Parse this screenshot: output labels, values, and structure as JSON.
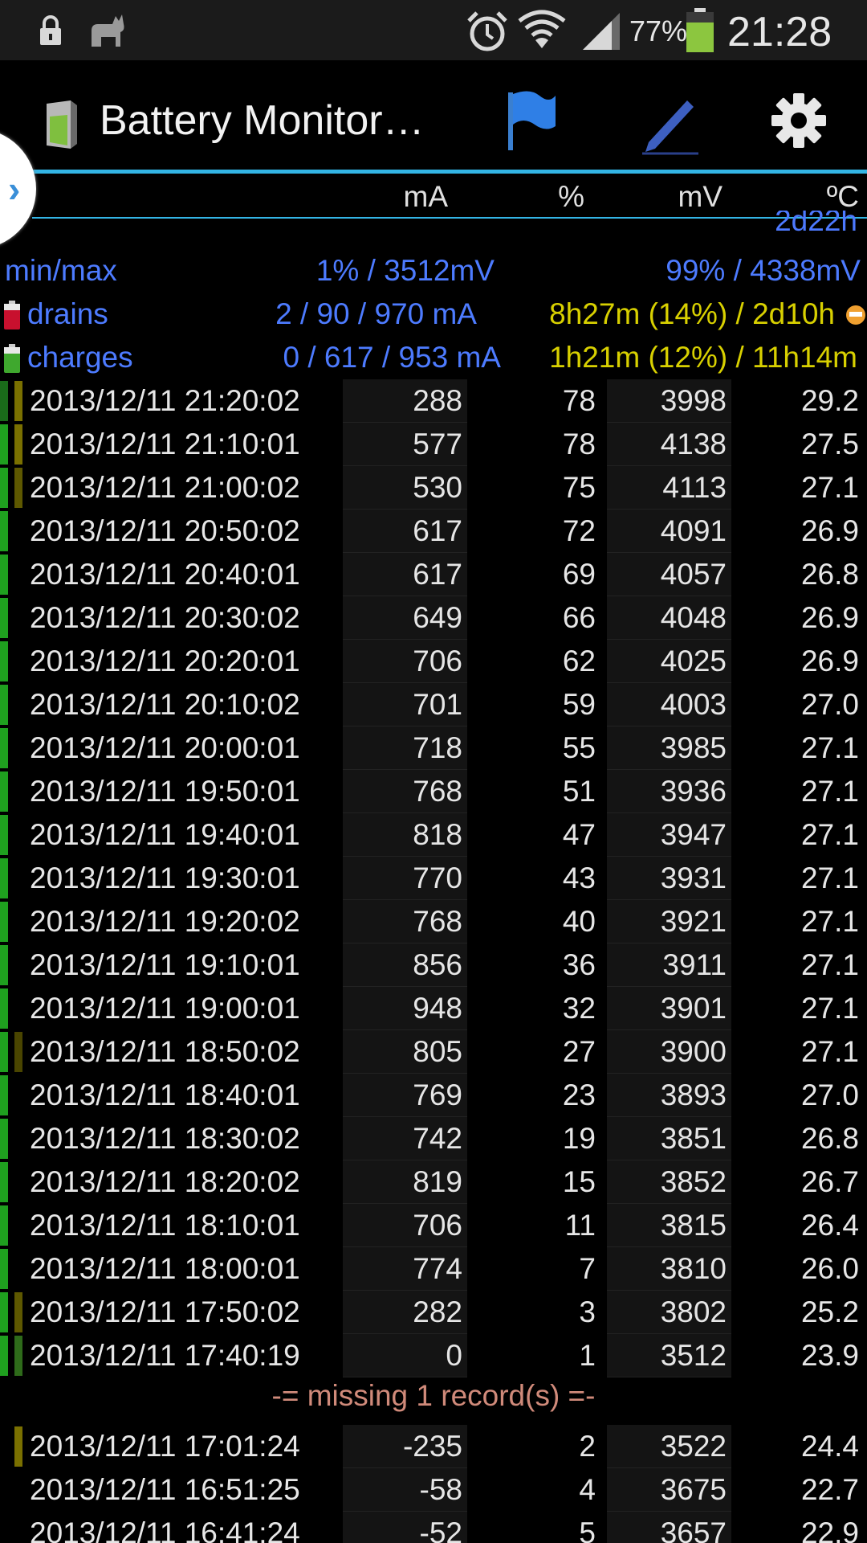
{
  "status_bar": {
    "battery_percent": "77%",
    "time": "21:28",
    "icons": [
      "lock-icon",
      "cat-icon",
      "alarm-icon",
      "wifi-icon",
      "signal-icon",
      "battery-icon"
    ]
  },
  "action_bar": {
    "title": "Battery Monitor…",
    "actions": [
      "flag-icon",
      "pencil-icon",
      "gear-icon"
    ]
  },
  "columns": {
    "ma": "mA",
    "pct": "%",
    "mv": "mV",
    "temp": "ºC"
  },
  "cut_text": "2d22h",
  "summary": {
    "minmax": {
      "label": "min/max",
      "left": "1% / 3512mV",
      "right": "99% / 4338mV"
    },
    "drains": {
      "label": "drains",
      "left": "2 / 90 / 970 mA",
      "right": "8h27m (14%) / 2d10h"
    },
    "charges": {
      "label": "charges",
      "left": "0 / 617 / 953 mA",
      "right": "1h21m (12%) / 11h14m"
    }
  },
  "rows": [
    {
      "ts": "2013/12/11  21:20:02",
      "ma": "288",
      "pct": "78",
      "mv": "3998",
      "temp": "29.2",
      "b1": "#1a6b1a",
      "b2": "#7a7000"
    },
    {
      "ts": "2013/12/11  21:10:01",
      "ma": "577",
      "pct": "78",
      "mv": "4138",
      "temp": "27.5",
      "b1": "#1fa01f",
      "b2": "#7a7000"
    },
    {
      "ts": "2013/12/11  21:00:02",
      "ma": "530",
      "pct": "75",
      "mv": "4113",
      "temp": "27.1",
      "b1": "#1fa01f",
      "b2": "#5e5800"
    },
    {
      "ts": "2013/12/11  20:50:02",
      "ma": "617",
      "pct": "72",
      "mv": "4091",
      "temp": "26.9",
      "b1": "#1fa01f",
      "b2": ""
    },
    {
      "ts": "2013/12/11  20:40:01",
      "ma": "617",
      "pct": "69",
      "mv": "4057",
      "temp": "26.8",
      "b1": "#1fa01f",
      "b2": ""
    },
    {
      "ts": "2013/12/11  20:30:02",
      "ma": "649",
      "pct": "66",
      "mv": "4048",
      "temp": "26.9",
      "b1": "#1fa01f",
      "b2": ""
    },
    {
      "ts": "2013/12/11  20:20:01",
      "ma": "706",
      "pct": "62",
      "mv": "4025",
      "temp": "26.9",
      "b1": "#1fa01f",
      "b2": ""
    },
    {
      "ts": "2013/12/11  20:10:02",
      "ma": "701",
      "pct": "59",
      "mv": "4003",
      "temp": "27.0",
      "b1": "#1fa01f",
      "b2": ""
    },
    {
      "ts": "2013/12/11  20:00:01",
      "ma": "718",
      "pct": "55",
      "mv": "3985",
      "temp": "27.1",
      "b1": "#1fa01f",
      "b2": ""
    },
    {
      "ts": "2013/12/11  19:50:01",
      "ma": "768",
      "pct": "51",
      "mv": "3936",
      "temp": "27.1",
      "b1": "#1fa01f",
      "b2": ""
    },
    {
      "ts": "2013/12/11  19:40:01",
      "ma": "818",
      "pct": "47",
      "mv": "3947",
      "temp": "27.1",
      "b1": "#1fa01f",
      "b2": ""
    },
    {
      "ts": "2013/12/11  19:30:01",
      "ma": "770",
      "pct": "43",
      "mv": "3931",
      "temp": "27.1",
      "b1": "#1fa01f",
      "b2": ""
    },
    {
      "ts": "2013/12/11  19:20:02",
      "ma": "768",
      "pct": "40",
      "mv": "3921",
      "temp": "27.1",
      "b1": "#1fa01f",
      "b2": ""
    },
    {
      "ts": "2013/12/11  19:10:01",
      "ma": "856",
      "pct": "36",
      "mv": "3911",
      "temp": "27.1",
      "b1": "#1fa01f",
      "b2": ""
    },
    {
      "ts": "2013/12/11  19:00:01",
      "ma": "948",
      "pct": "32",
      "mv": "3901",
      "temp": "27.1",
      "b1": "#1fa01f",
      "b2": ""
    },
    {
      "ts": "2013/12/11  18:50:02",
      "ma": "805",
      "pct": "27",
      "mv": "3900",
      "temp": "27.1",
      "b1": "#1fa01f",
      "b2": "#4a4500"
    },
    {
      "ts": "2013/12/11  18:40:01",
      "ma": "769",
      "pct": "23",
      "mv": "3893",
      "temp": "27.0",
      "b1": "#1fa01f",
      "b2": ""
    },
    {
      "ts": "2013/12/11  18:30:02",
      "ma": "742",
      "pct": "19",
      "mv": "3851",
      "temp": "26.8",
      "b1": "#1fa01f",
      "b2": ""
    },
    {
      "ts": "2013/12/11  18:20:02",
      "ma": "819",
      "pct": "15",
      "mv": "3852",
      "temp": "26.7",
      "b1": "#1fa01f",
      "b2": ""
    },
    {
      "ts": "2013/12/11  18:10:01",
      "ma": "706",
      "pct": "11",
      "mv": "3815",
      "temp": "26.4",
      "b1": "#1fa01f",
      "b2": ""
    },
    {
      "ts": "2013/12/11  18:00:01",
      "ma": "774",
      "pct": "7",
      "mv": "3810",
      "temp": "26.0",
      "b1": "#1fa01f",
      "b2": ""
    },
    {
      "ts": "2013/12/11  17:50:02",
      "ma": "282",
      "pct": "3",
      "mv": "3802",
      "temp": "25.2",
      "b1": "#1fa01f",
      "b2": "#5e5800"
    },
    {
      "ts": "2013/12/11  17:40:19",
      "ma": "0",
      "pct": "1",
      "mv": "3512",
      "temp": "23.9",
      "b1": "#1fa01f",
      "b2": "#2e6b1a"
    }
  ],
  "missing_text": "-= missing 1 record(s) =-",
  "rows_after": [
    {
      "ts": "2013/12/11  17:01:24",
      "ma": "-235",
      "pct": "2",
      "mv": "3522",
      "temp": "24.4",
      "b1": "",
      "b2": "#7a7000"
    },
    {
      "ts": "2013/12/11  16:51:25",
      "ma": "-58",
      "pct": "4",
      "mv": "3675",
      "temp": "22.7",
      "b1": "",
      "b2": ""
    },
    {
      "ts": "2013/12/11  16:41:24",
      "ma": "-52",
      "pct": "5",
      "mv": "3657",
      "temp": "22.9",
      "b1": "",
      "b2": ""
    }
  ]
}
